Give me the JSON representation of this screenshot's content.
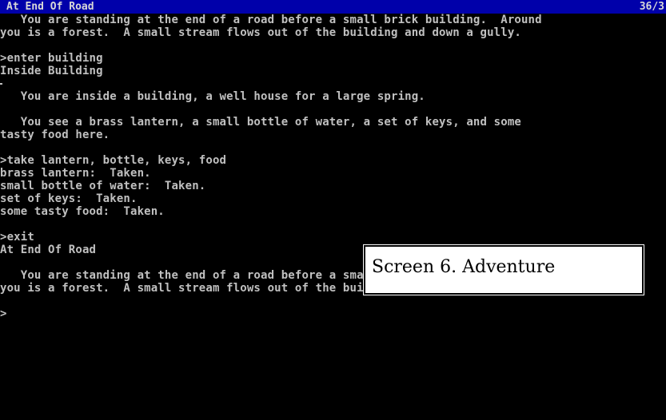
{
  "status_bar": {
    "location": "At End Of Road",
    "score": "36/3"
  },
  "transcript": {
    "lines": [
      "   You are standing at the end of a road before a small brick building.  Around",
      "you is a forest.  A small stream flows out of the building and down a gully.",
      "",
      ">enter building",
      "Inside Building",
      "",
      "   You are inside a building, a well house for a large spring.",
      "",
      "   You see a brass lantern, a small bottle of water, a set of keys, and some",
      "tasty food here.",
      "",
      ">take lantern, bottle, keys, food",
      "brass lantern:  Taken.",
      "small bottle of water:  Taken.",
      "set of keys:  Taken.",
      "some tasty food:  Taken.",
      "",
      ">exit",
      "At End Of Road",
      "",
      "   You are standing at the end of a road before a small brick building.  Around",
      "you is a forest.  A small stream flows out of the building and down a gully.",
      "",
      ">"
    ]
  },
  "caption": {
    "text": "Screen 6. Adventure"
  },
  "colors": {
    "status_background": "#0000aa",
    "text": "#c0c0c0",
    "background": "#000000"
  }
}
